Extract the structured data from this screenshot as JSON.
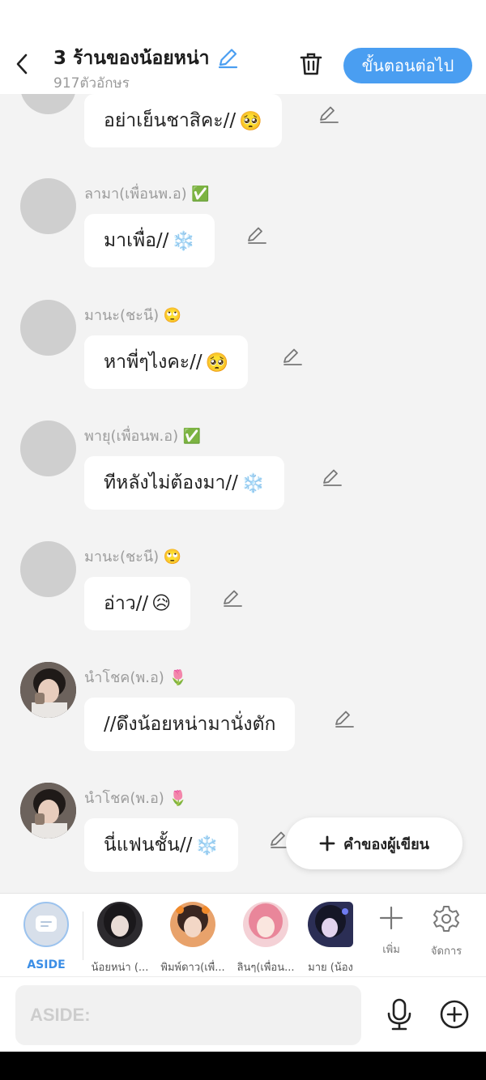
{
  "header": {
    "title": "3 ร้านของน้อยหน่า",
    "subtitle": "917ตัวอักษร",
    "next_label": "ขั้นตอนต่อไป"
  },
  "messages": [
    {
      "name": "",
      "text": "อย่าเย็นชาสิคะ//",
      "emoji": "🥺",
      "avatar": "blank"
    },
    {
      "name": "ลามา(เพื่อนพ.อ)",
      "name_emoji": "✅",
      "text": "มาเพื่อ//",
      "emoji": "❄️",
      "avatar": "blank"
    },
    {
      "name": "มานะ(ชะนี)",
      "name_emoji": "🙄",
      "text": "หาพี่ๆไงคะ//",
      "emoji": "🥺",
      "avatar": "blank"
    },
    {
      "name": "พายุ(เพื่อนพ.อ)",
      "name_emoji": "✅",
      "text": "ทีหลังไม่ต้องมา//",
      "emoji": "❄️",
      "avatar": "blank"
    },
    {
      "name": "มานะ(ชะนี)",
      "name_emoji": "🙄",
      "text": "อ่าว//",
      "emoji": "😥",
      "avatar": "blank"
    },
    {
      "name": "นำโชค(พ.อ)",
      "name_emoji": "🌷",
      "text": "//ดึงน้อยหน่ามานั่งตัก",
      "emoji": "",
      "avatar": "photo"
    },
    {
      "name": "นำโชค(พ.อ)",
      "name_emoji": "🌷",
      "text": "นี่แฟนชั้น//",
      "emoji": "❄️",
      "avatar": "photo"
    }
  ],
  "author_button": "คำของผู้เขียน",
  "characters": [
    {
      "label": "ASIDE"
    },
    {
      "label": "น้อยหน่า (..."
    },
    {
      "label": "พิมพ์ดาว(เพื่..."
    },
    {
      "label": "ลินๆ(เพื่อน..."
    },
    {
      "label": "มาย (น้อง"
    }
  ],
  "tools": {
    "add_label": "เพิ่ม",
    "manage_label": "จัดการ"
  },
  "input": {
    "placeholder": "ASIDE:"
  },
  "colors": {
    "accent": "#4a9ef1",
    "bubble": "#ffffff",
    "background": "#f3f3f3"
  }
}
